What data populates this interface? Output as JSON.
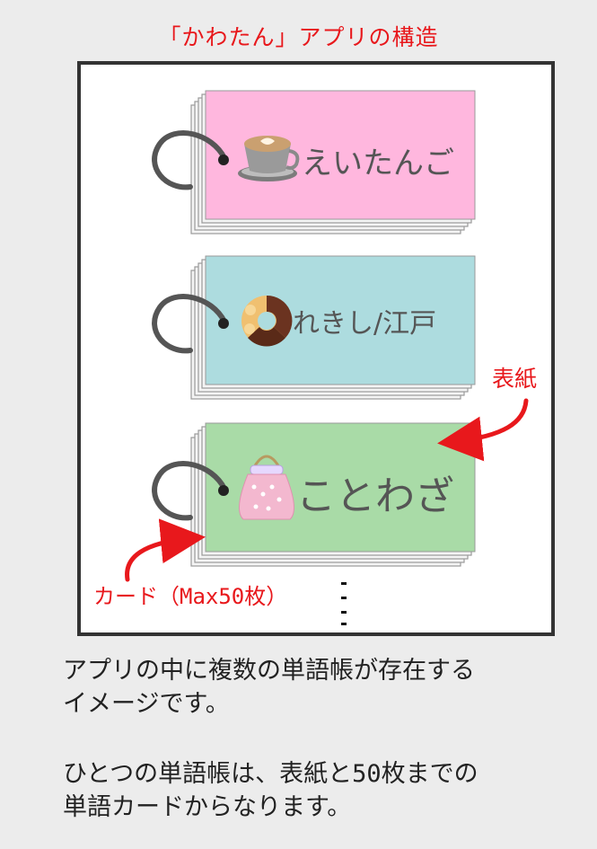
{
  "title": "「かわたん」アプリの構造",
  "books": [
    {
      "label": "えいたんご",
      "icon": "coffee-cup-icon",
      "color": "#ffb7de"
    },
    {
      "label": "れきし/江戸",
      "icon": "donut-icon",
      "color": "#addcdf"
    },
    {
      "label": "ことわざ",
      "icon": "handbag-icon",
      "color": "#a9dba7"
    }
  ],
  "annotations": {
    "cover": "表紙",
    "card": "カード（Max50枚）"
  },
  "description": {
    "paragraph1": [
      "アプリの中に複数の単語帳が存在する",
      "イメージです。"
    ],
    "paragraph2": [
      "ひとつの単語帳は、表紙と50枚までの",
      "単語カードからなります。"
    ]
  },
  "colors": {
    "accent_red": "#e8181c",
    "ring": "#555555",
    "frame": "#333333"
  }
}
